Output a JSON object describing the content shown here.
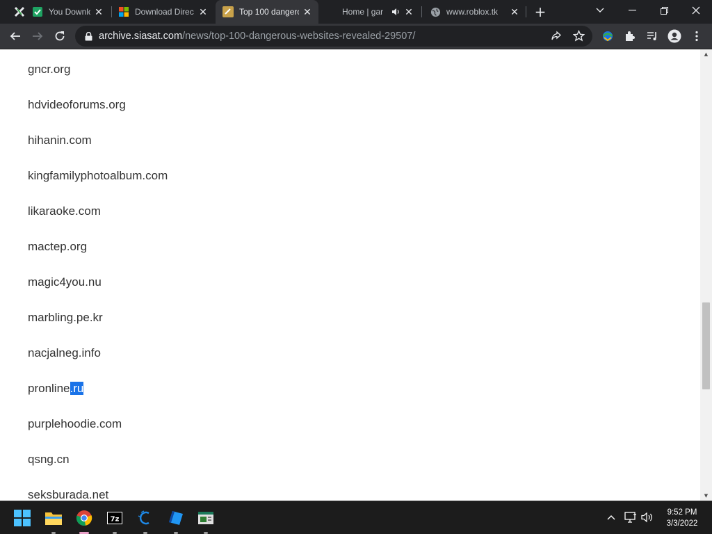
{
  "browser": {
    "tabs": [
      {
        "title": "You Downlo",
        "favicon": "green-check-icon"
      },
      {
        "title": "Download Direc",
        "favicon": "microsoft-logo-icon"
      },
      {
        "title": "Top 100 dangero",
        "favicon": "siasat-icon",
        "active": true
      },
      {
        "title": "Home | gar",
        "favicon": "none",
        "audio": true
      },
      {
        "title": "www.roblox.tk",
        "favicon": "globe-icon"
      }
    ],
    "url_host": "archive.siasat.com",
    "url_path": "/news/top-100-dangerous-websites-revealed-29507/"
  },
  "page": {
    "sites": [
      "gncr.org",
      "hdvideoforums.org",
      "hihanin.com",
      "kingfamilyphotoalbum.com",
      "likaraoke.com",
      "mactep.org",
      "magic4you.nu",
      "marbling.pe.kr",
      "nacjalneg.info",
      "pronline.ru",
      "purplehoodie.com",
      "qsng.cn",
      "seksburada.net"
    ],
    "selected": {
      "prefix": "pronline",
      "highlight": ".ru"
    }
  },
  "taskbar": {
    "apps": [
      "start-icon",
      "file-explorer-icon",
      "chrome-icon",
      "7zip-icon",
      "app-icon",
      "roblox-studio-icon",
      "editor-icon"
    ],
    "clock_time": "9:52 PM",
    "clock_date": "3/3/2022"
  }
}
